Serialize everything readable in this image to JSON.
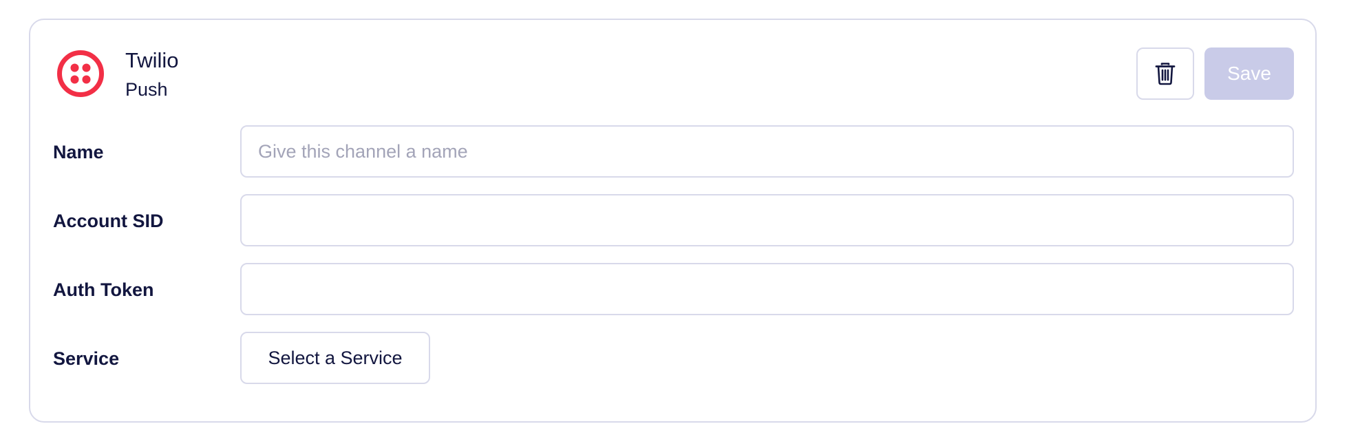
{
  "channel": {
    "provider_name": "Twilio",
    "channel_type": "Push",
    "logo_icon": "twilio-logo-icon",
    "brand_color": "#f22f46"
  },
  "actions": {
    "delete_icon": "trash-icon",
    "save_label": "Save",
    "save_disabled_color": "#c9cbe8"
  },
  "form": {
    "name": {
      "label": "Name",
      "value": "",
      "placeholder": "Give this channel a name"
    },
    "account_sid": {
      "label": "Account SID",
      "value": "",
      "placeholder": ""
    },
    "auth_token": {
      "label": "Auth Token",
      "value": "",
      "placeholder": ""
    },
    "service": {
      "label": "Service",
      "selected_label": "Select a Service"
    }
  }
}
